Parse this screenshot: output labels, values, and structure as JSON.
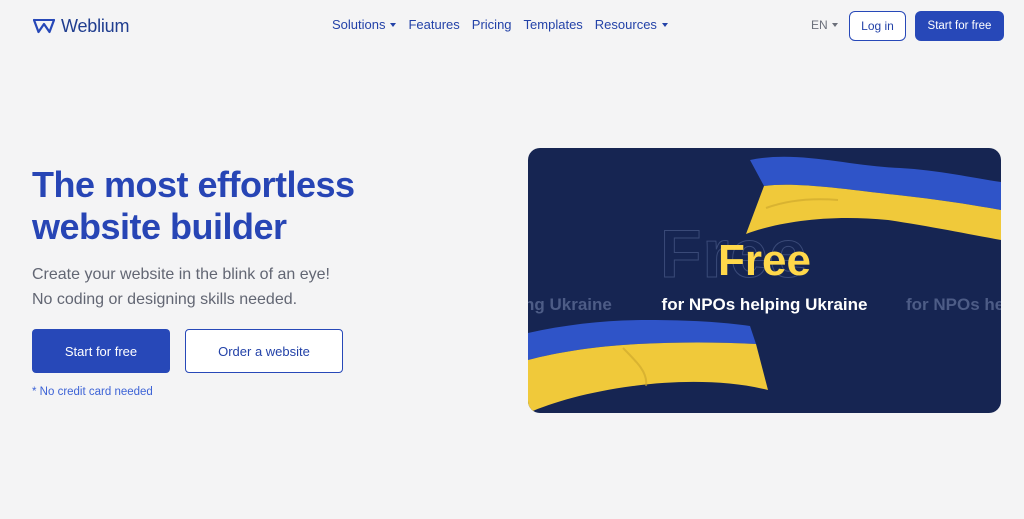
{
  "brand": {
    "name": "Weblium",
    "icon": "weblium-logo-icon"
  },
  "nav": {
    "items": [
      {
        "label": "Solutions",
        "dropdown": true
      },
      {
        "label": "Features",
        "dropdown": false
      },
      {
        "label": "Pricing",
        "dropdown": false
      },
      {
        "label": "Templates",
        "dropdown": false
      },
      {
        "label": "Resources",
        "dropdown": true
      }
    ],
    "language": "EN",
    "login_label": "Log in",
    "start_label": "Start for free"
  },
  "hero": {
    "title_line1": "The most effortless",
    "title_line2": "website builder",
    "subtitle_line1": "Create your website in the blink of an eye!",
    "subtitle_line2": "No coding or designing skills needed.",
    "primary_button": "Start for free",
    "secondary_button": "Order a website",
    "note": "* No credit card needed"
  },
  "promo": {
    "headline": "Free",
    "tagline": "for NPOs helping Ukraine",
    "ghost_left": "ng Ukraine",
    "ghost_right": "for NPOs he",
    "flag_colors": {
      "blue": "#2f54c8",
      "yellow": "#f0c93a"
    }
  },
  "colors": {
    "accent": "#2748b8",
    "background": "#f4f4f5",
    "promo_background": "#162552",
    "promo_yellow": "#ffd84a"
  }
}
